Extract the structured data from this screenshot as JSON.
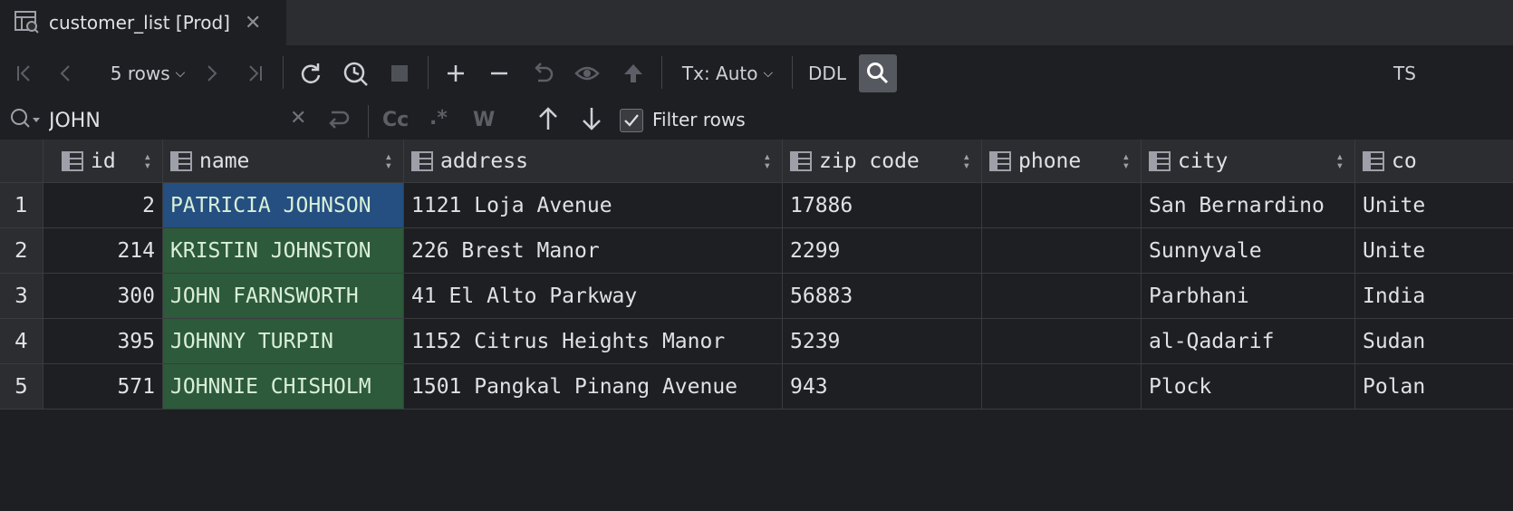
{
  "tab": {
    "title": "customer_list [Prod]"
  },
  "toolbar": {
    "rows_label": "5 rows",
    "tx_label": "Tx: Auto",
    "ddl_label": "DDL",
    "right_label": "TS"
  },
  "filter": {
    "search_value": "JOHN",
    "case_label": "Cc",
    "regex_label": ".*",
    "words_label": "W",
    "filter_rows_label": "Filter rows",
    "filter_rows_checked": true
  },
  "table": {
    "columns": [
      "id",
      "name",
      "address",
      "zip code",
      "phone",
      "city",
      "co"
    ],
    "rows": [
      {
        "num": "1",
        "id": "2",
        "name": "PATRICIA JOHNSON",
        "address": "1121 Loja Avenue",
        "zip": "17886",
        "phone": "",
        "city": "San Bernardino",
        "country": "Unite"
      },
      {
        "num": "2",
        "id": "214",
        "name": "KRISTIN JOHNSTON",
        "address": "226 Brest Manor",
        "zip": "2299",
        "phone": "",
        "city": "Sunnyvale",
        "country": "Unite"
      },
      {
        "num": "3",
        "id": "300",
        "name": "JOHN FARNSWORTH",
        "address": "41 El Alto Parkway",
        "zip": "56883",
        "phone": "",
        "city": "Parbhani",
        "country": "India"
      },
      {
        "num": "4",
        "id": "395",
        "name": "JOHNNY TURPIN",
        "address": "1152 Citrus Heights Manor",
        "zip": "5239",
        "phone": "",
        "city": "al-Qadarif",
        "country": "Sudan"
      },
      {
        "num": "5",
        "id": "571",
        "name": "JOHNNIE CHISHOLM",
        "address": "1501 Pangkal Pinang Avenue",
        "zip": "943",
        "phone": "",
        "city": "Plock",
        "country": "Polan"
      }
    ]
  },
  "colors": {
    "match": "#2d5a3a",
    "selected": "#244f80",
    "background": "#1e1f22"
  }
}
